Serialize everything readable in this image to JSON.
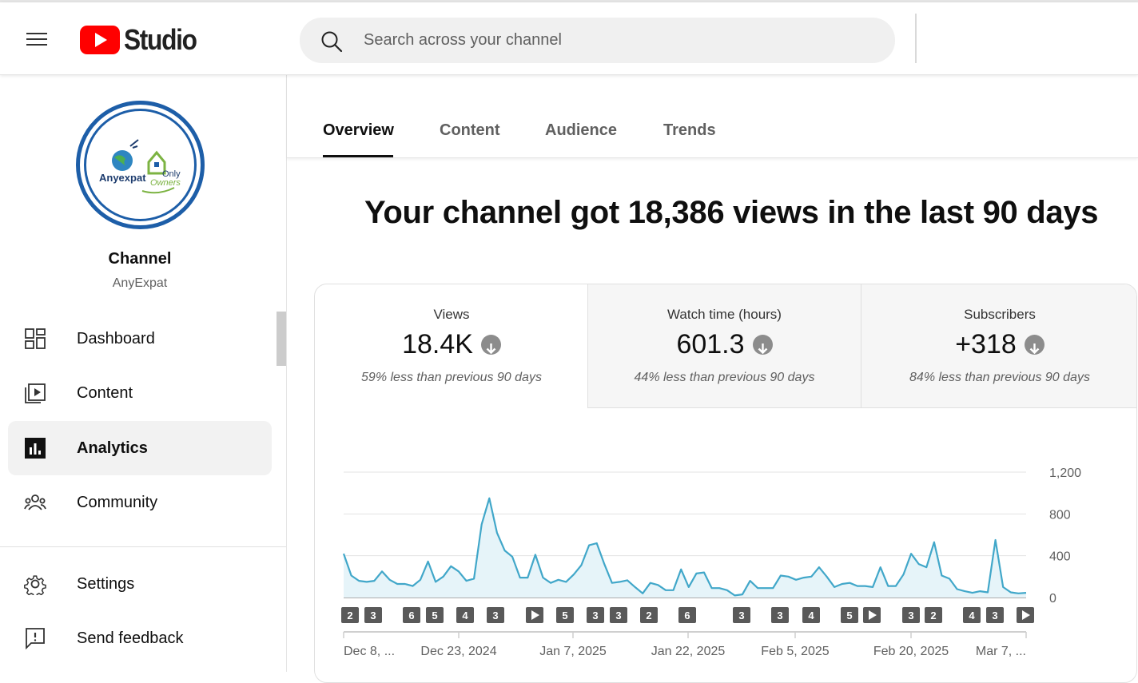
{
  "header": {
    "logo_text": "Studio",
    "search_placeholder": "Search across your channel",
    "icons": [
      "menu-icon",
      "youtube-logo-icon",
      "search-icon"
    ]
  },
  "sidebar": {
    "avatar_logo_text_left": "Anyexpat",
    "avatar_logo_text_right_1": "Only",
    "avatar_logo_text_right_2": "Owners",
    "channel_title": "Channel",
    "channel_name": "AnyExpat",
    "items": [
      {
        "label": "Dashboard",
        "icon": "dashboard-icon",
        "active": false
      },
      {
        "label": "Content",
        "icon": "content-icon",
        "active": false
      },
      {
        "label": "Analytics",
        "icon": "analytics-icon",
        "active": true
      },
      {
        "label": "Community",
        "icon": "community-icon",
        "active": false
      },
      {
        "label": "Settings",
        "icon": "settings-icon",
        "active": false
      },
      {
        "label": "Send feedback",
        "icon": "feedback-icon",
        "active": false
      }
    ]
  },
  "tabs": [
    {
      "label": "Overview",
      "active": true
    },
    {
      "label": "Content",
      "active": false
    },
    {
      "label": "Audience",
      "active": false
    },
    {
      "label": "Trends",
      "active": false
    }
  ],
  "headline": "Your channel got 18,386 views in the last 90 days",
  "metrics": [
    {
      "label": "Views",
      "value": "18.4K",
      "trend": "down",
      "note": "59% less than previous 90 days",
      "selected": true
    },
    {
      "label": "Watch time (hours)",
      "value": "601.3",
      "trend": "down",
      "note": "44% less than previous 90 days",
      "selected": false
    },
    {
      "label": "Subscribers",
      "value": "+318",
      "trend": "down",
      "note": "84% less than previous 90 days",
      "selected": false
    }
  ],
  "colors": {
    "line": "#41a7c9",
    "fill": "#e6f4f9",
    "accent": "#ff0000",
    "badge": "#595959"
  },
  "chart_data": {
    "type": "area",
    "title": "",
    "xlabel": "",
    "ylabel": "",
    "ylim": [
      0,
      1200
    ],
    "yticks": [
      0,
      400,
      800,
      1200
    ],
    "ytick_labels": [
      "0",
      "400",
      "800",
      "1,200"
    ],
    "xtick_labels": [
      "Dec 8, ...",
      "Dec 23, 2024",
      "Jan 7, 2025",
      "Jan 22, 2025",
      "Feb 5, 2025",
      "Feb 20, 2025",
      "Mar 7, ..."
    ],
    "grid": true,
    "series": [
      {
        "values": [
          420,
          210,
          160,
          150,
          160,
          250,
          170,
          130,
          130,
          110,
          170,
          345,
          150,
          200,
          300,
          250,
          160,
          180,
          700,
          950,
          620,
          450,
          390,
          190,
          190,
          410,
          190,
          140,
          170,
          150,
          220,
          310,
          500,
          520,
          320,
          140,
          150,
          165,
          100,
          40,
          140,
          120,
          70,
          70,
          270,
          100,
          230,
          240,
          90,
          90,
          70,
          20,
          30,
          160,
          90,
          90,
          90,
          210,
          200,
          170,
          190,
          200,
          290,
          200,
          100,
          130,
          140,
          110,
          110,
          100,
          290,
          110,
          110,
          220,
          420,
          320,
          290,
          530,
          210,
          180,
          80,
          60,
          45,
          60,
          50,
          550,
          100,
          50,
          40,
          45
        ]
      }
    ],
    "annotation_markers": [
      "2",
      "3",
      "6",
      "5",
      "4",
      "3",
      "play",
      "5",
      "3",
      "3",
      "2",
      "6",
      "3",
      "3",
      "4",
      "5",
      "play",
      "3",
      "2",
      "4",
      "3",
      "play"
    ]
  }
}
